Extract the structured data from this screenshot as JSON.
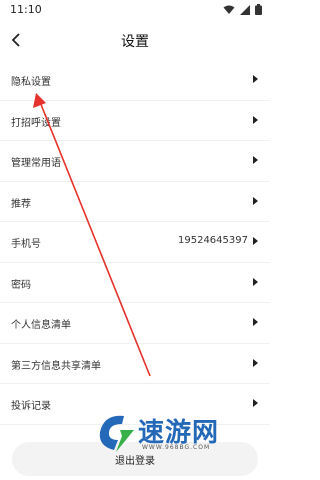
{
  "status_bar": {
    "time": "11:10"
  },
  "header": {
    "title": "设置",
    "back_icon": "chevron-left-icon"
  },
  "menu": {
    "items": [
      {
        "label": "隐私设置",
        "value": ""
      },
      {
        "label": "打招呼设置",
        "value": ""
      },
      {
        "label": "管理常用语",
        "value": ""
      },
      {
        "label": "推荐",
        "value": ""
      },
      {
        "label": "手机号",
        "value": "19524645397"
      },
      {
        "label": "密码",
        "value": ""
      },
      {
        "label": "个人信息清单",
        "value": ""
      },
      {
        "label": "第三方信息共享清单",
        "value": ""
      },
      {
        "label": "投诉记录",
        "value": ""
      }
    ]
  },
  "footer": {
    "logout_label": "退出登录"
  },
  "watermark": {
    "brand": "速游网",
    "url": "WWW.968BG.COM"
  },
  "colors": {
    "arrow": "#e5322d",
    "watermark": "#2468b8"
  }
}
